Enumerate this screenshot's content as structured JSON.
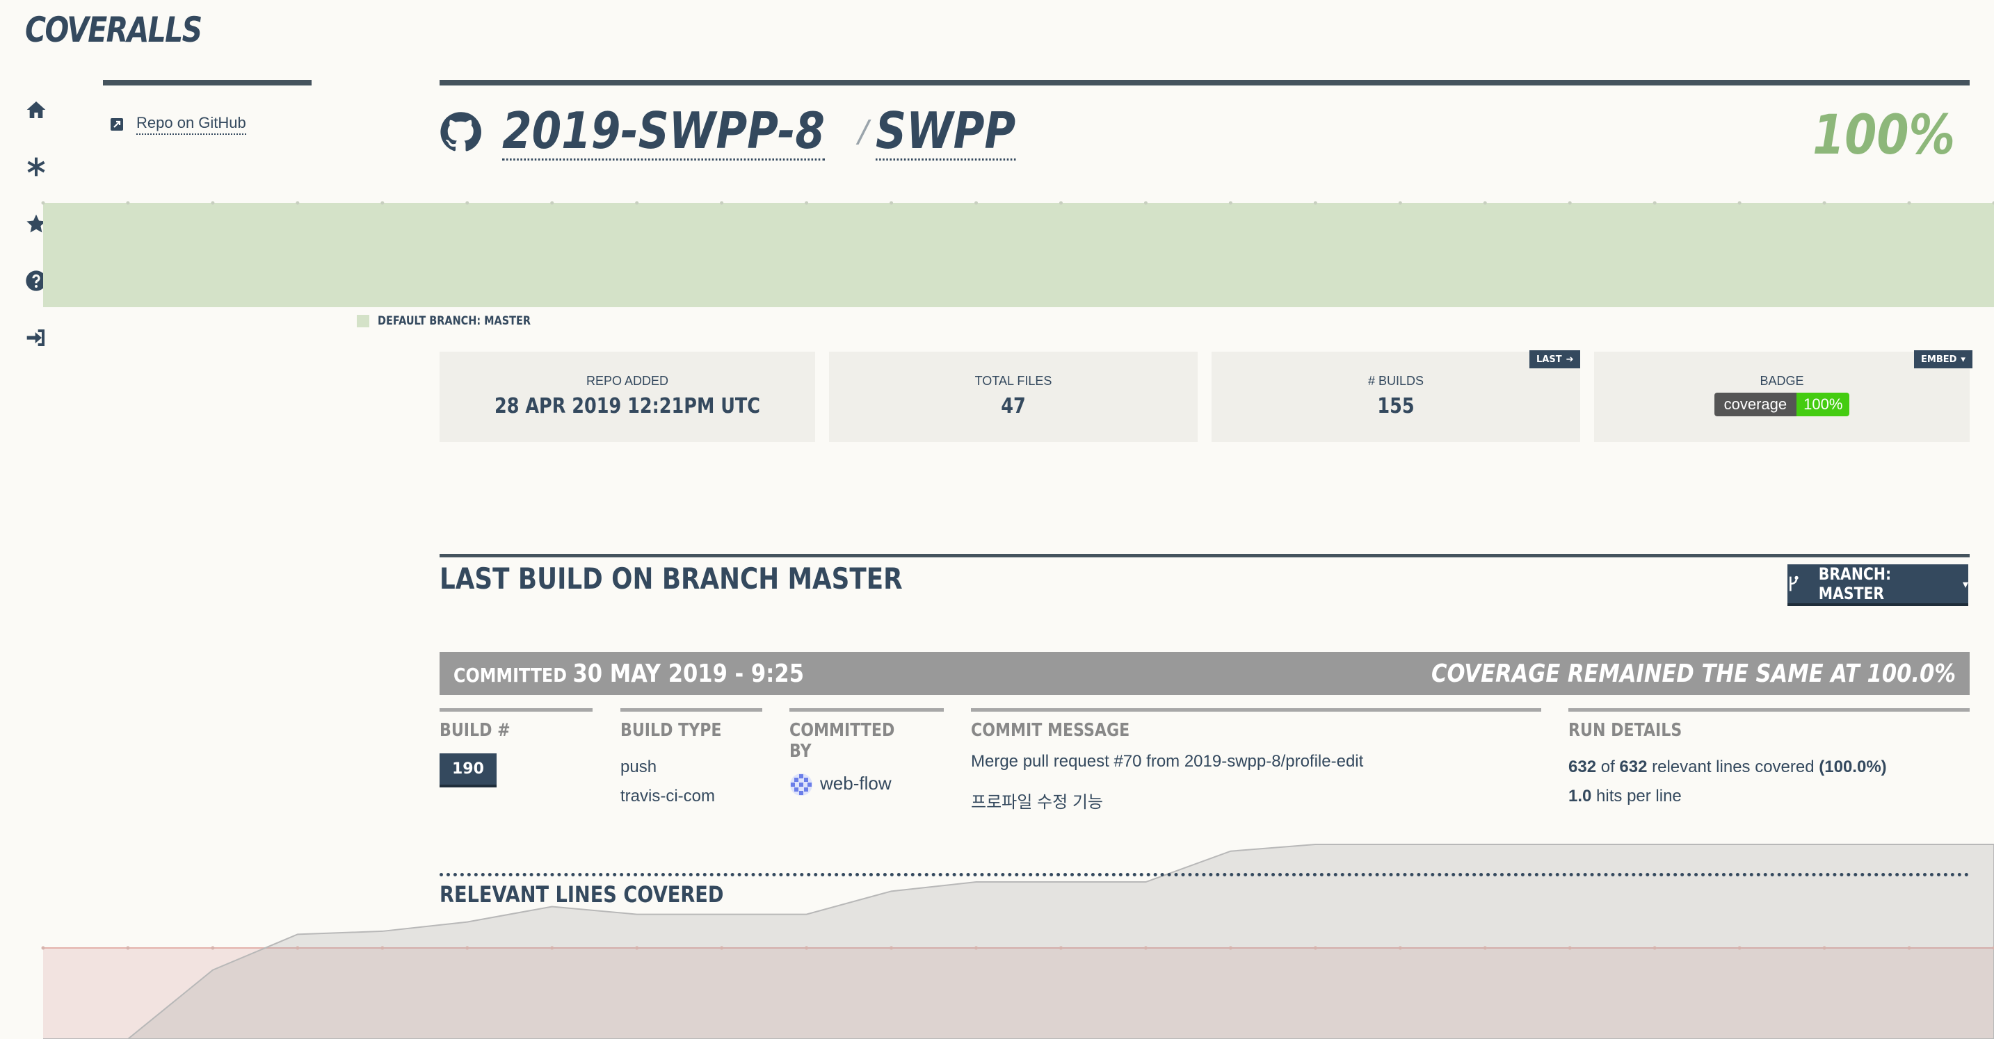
{
  "brand": "COVERALLS",
  "nav_icons": [
    "home-icon",
    "asterisk-icon",
    "star-icon",
    "help-icon",
    "sign-in-icon"
  ],
  "sidebar": {
    "repo_link": "Repo on GitHub"
  },
  "repo": {
    "owner": "2019-SWPP-8",
    "separator": "/",
    "name": "SWPP",
    "coverage": "100%"
  },
  "legend": {
    "label": "DEFAULT BRANCH: MASTER"
  },
  "stats": {
    "repo_added": {
      "label": "REPO ADDED",
      "value": "28 APR 2019 12:21PM UTC"
    },
    "total_files": {
      "label": "TOTAL FILES",
      "value": "47"
    },
    "builds": {
      "label": "# BUILDS",
      "value": "155",
      "tag": "LAST"
    },
    "badge": {
      "label": "BADGE",
      "tag": "EMBED",
      "left": "coverage",
      "right": "100%"
    }
  },
  "last_build": {
    "title": "LAST BUILD ON BRANCH MASTER",
    "branch_button": "BRANCH: MASTER",
    "committed_label": "COMMITTED",
    "committed_date": "30 MAY 2019 - 9:25",
    "coverage_summary": "COVERAGE REMAINED THE SAME AT 100.0%",
    "build_header": "BUILD #",
    "build_number": "190",
    "build_type_header": "BUILD TYPE",
    "build_type": "push",
    "build_service": "travis-ci-com",
    "committed_by_header": "COMMITTED BY",
    "committed_by": "web-flow",
    "message_header": "COMMIT MESSAGE",
    "message_line1": "Merge pull request #70 from 2019-swpp-8/profile-edit",
    "message_line2": "프로파일 수정 기능",
    "run_header": "RUN DETAILS",
    "run_covered": "632",
    "run_of": "of",
    "run_total": "632",
    "run_relevant": "relevant lines covered",
    "run_pct": "(100.0%)",
    "hits": "1.0",
    "hits_label": "hits per line"
  },
  "relevant_lines_title": "RELEVANT LINES COVERED",
  "colors": {
    "accent": "#34495e",
    "coverage_green": "#8db77a",
    "badge_green": "#44cc11",
    "commit_bar": "#999999"
  },
  "chart_data": {
    "type": "area",
    "coverage_series": {
      "values": [
        100,
        100,
        100,
        100,
        100,
        100,
        100,
        100,
        100,
        100,
        100,
        100,
        100,
        100,
        100,
        100,
        100,
        100,
        100,
        100,
        100,
        100,
        100,
        100
      ]
    },
    "relevant_lines_series": {
      "values": [
        0,
        0,
        224,
        340,
        350,
        380,
        430,
        405,
        405,
        405,
        480,
        510,
        510,
        510,
        610,
        632,
        632,
        632,
        632,
        632,
        632,
        632,
        632,
        632
      ]
    }
  }
}
